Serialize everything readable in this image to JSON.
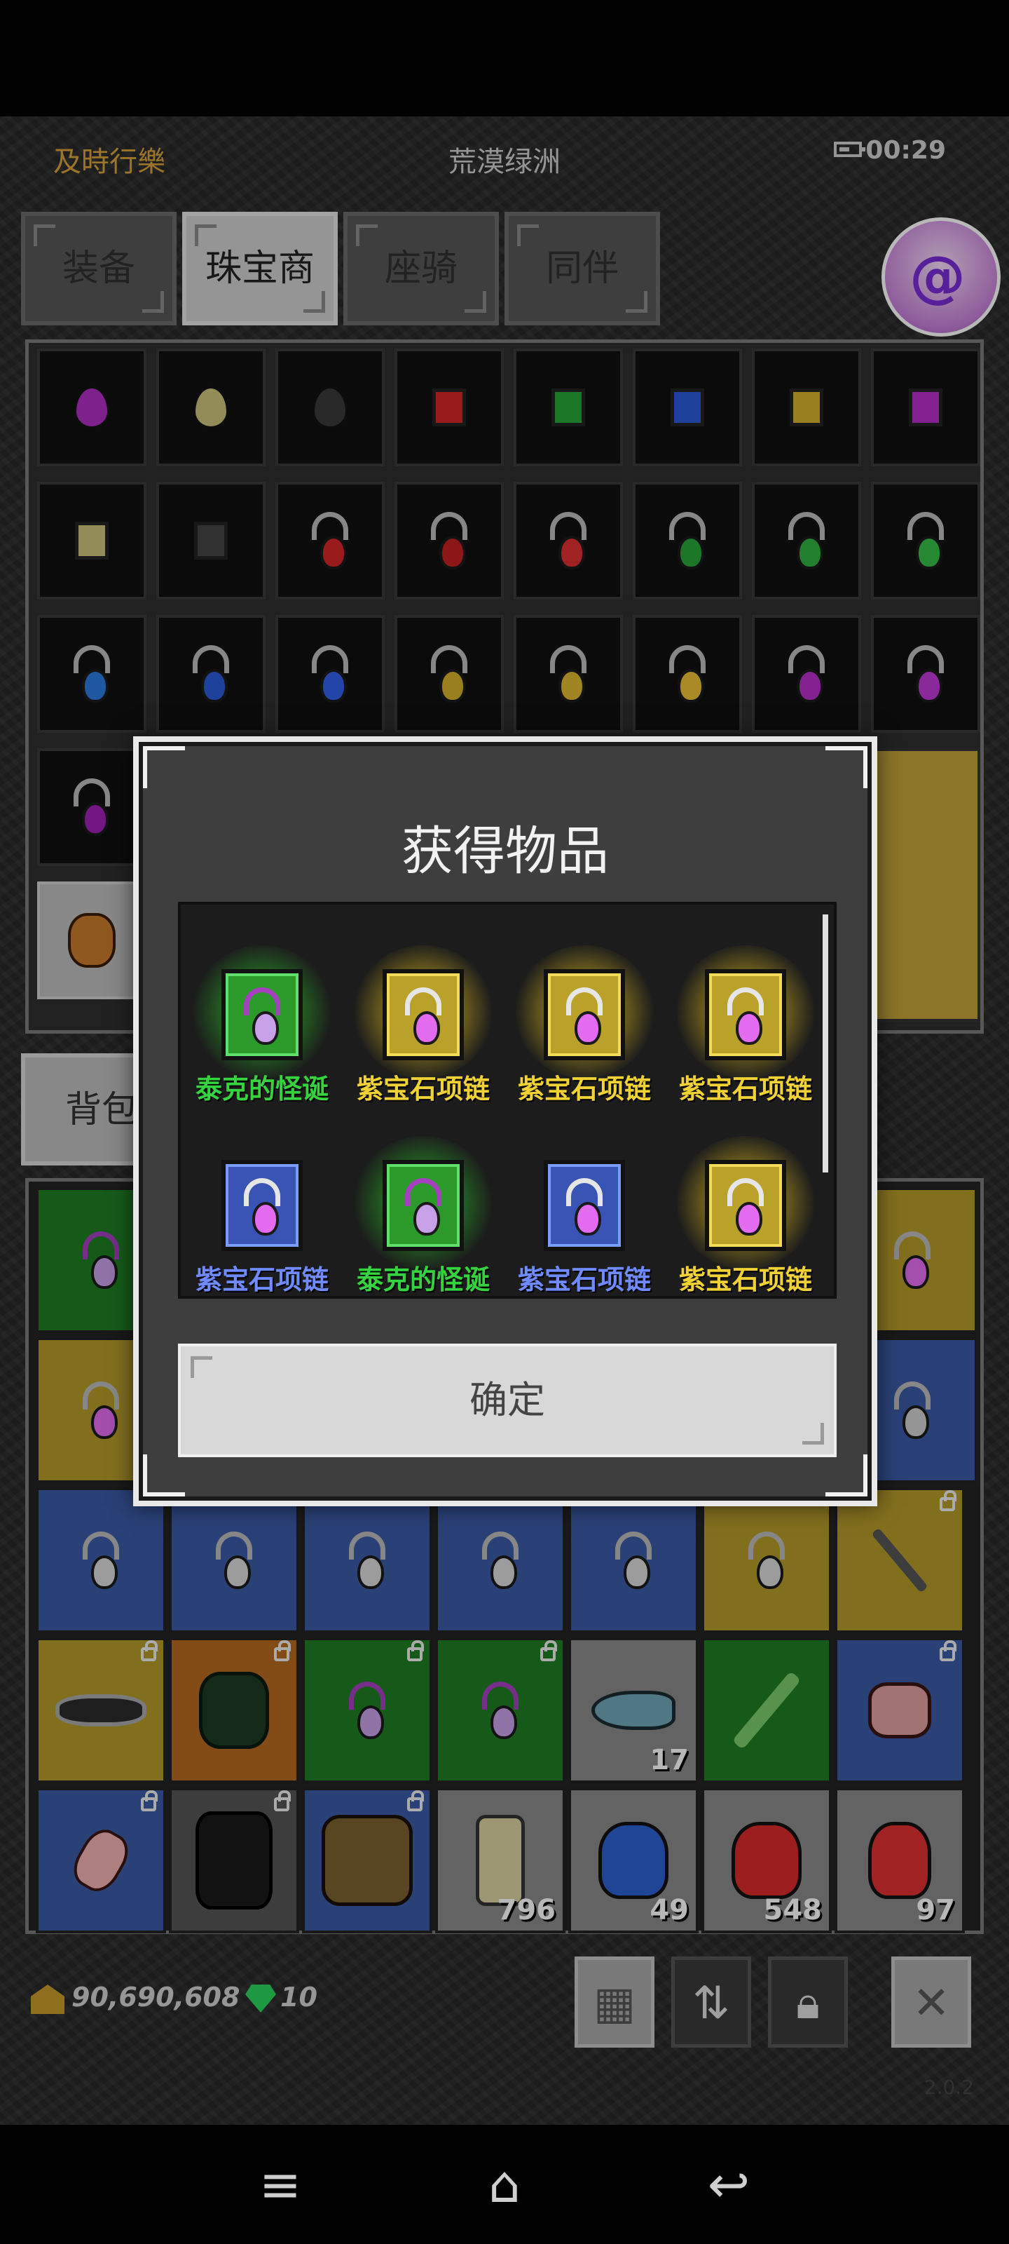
{
  "topbar": {
    "left_label": "及時行樂",
    "location": "荒漠绿洲",
    "clock": "00:29"
  },
  "tabs": [
    {
      "label": "装备",
      "active": false
    },
    {
      "label": "珠宝商",
      "active": true
    },
    {
      "label": "座骑",
      "active": false
    },
    {
      "label": "同伴",
      "active": false
    }
  ],
  "bag": {
    "tab_label": "背包"
  },
  "currency": {
    "gold": "90,690,608",
    "gems": "10"
  },
  "inventory_counts": [
    "17",
    "796",
    "49",
    "548",
    "97"
  ],
  "version": "2.0.2",
  "dialog": {
    "title": "获得物品",
    "confirm_label": "确定",
    "rewards": [
      {
        "label": "泰克的怪诞",
        "rarity": "green"
      },
      {
        "label": "紫宝石项链",
        "rarity": "yellow"
      },
      {
        "label": "紫宝石项链",
        "rarity": "yellow"
      },
      {
        "label": "紫宝石项链",
        "rarity": "yellow"
      },
      {
        "label": "紫宝石项链",
        "rarity": "blue"
      },
      {
        "label": "泰克的怪诞",
        "rarity": "green"
      },
      {
        "label": "紫宝石项链",
        "rarity": "blue"
      },
      {
        "label": "紫宝石项链",
        "rarity": "yellow"
      }
    ]
  },
  "colors": {
    "accent_gold": "#d8a23c",
    "rarity_green": "#35d33d",
    "rarity_yellow": "#f1d235",
    "rarity_blue": "#6f8bff"
  },
  "icons": [
    "battery-icon",
    "app-badge-icon",
    "gold-icon",
    "gem-icon",
    "grid-icon",
    "sort-icon",
    "lock-icon",
    "close-icon",
    "menu-icon",
    "home-icon",
    "back-icon"
  ]
}
